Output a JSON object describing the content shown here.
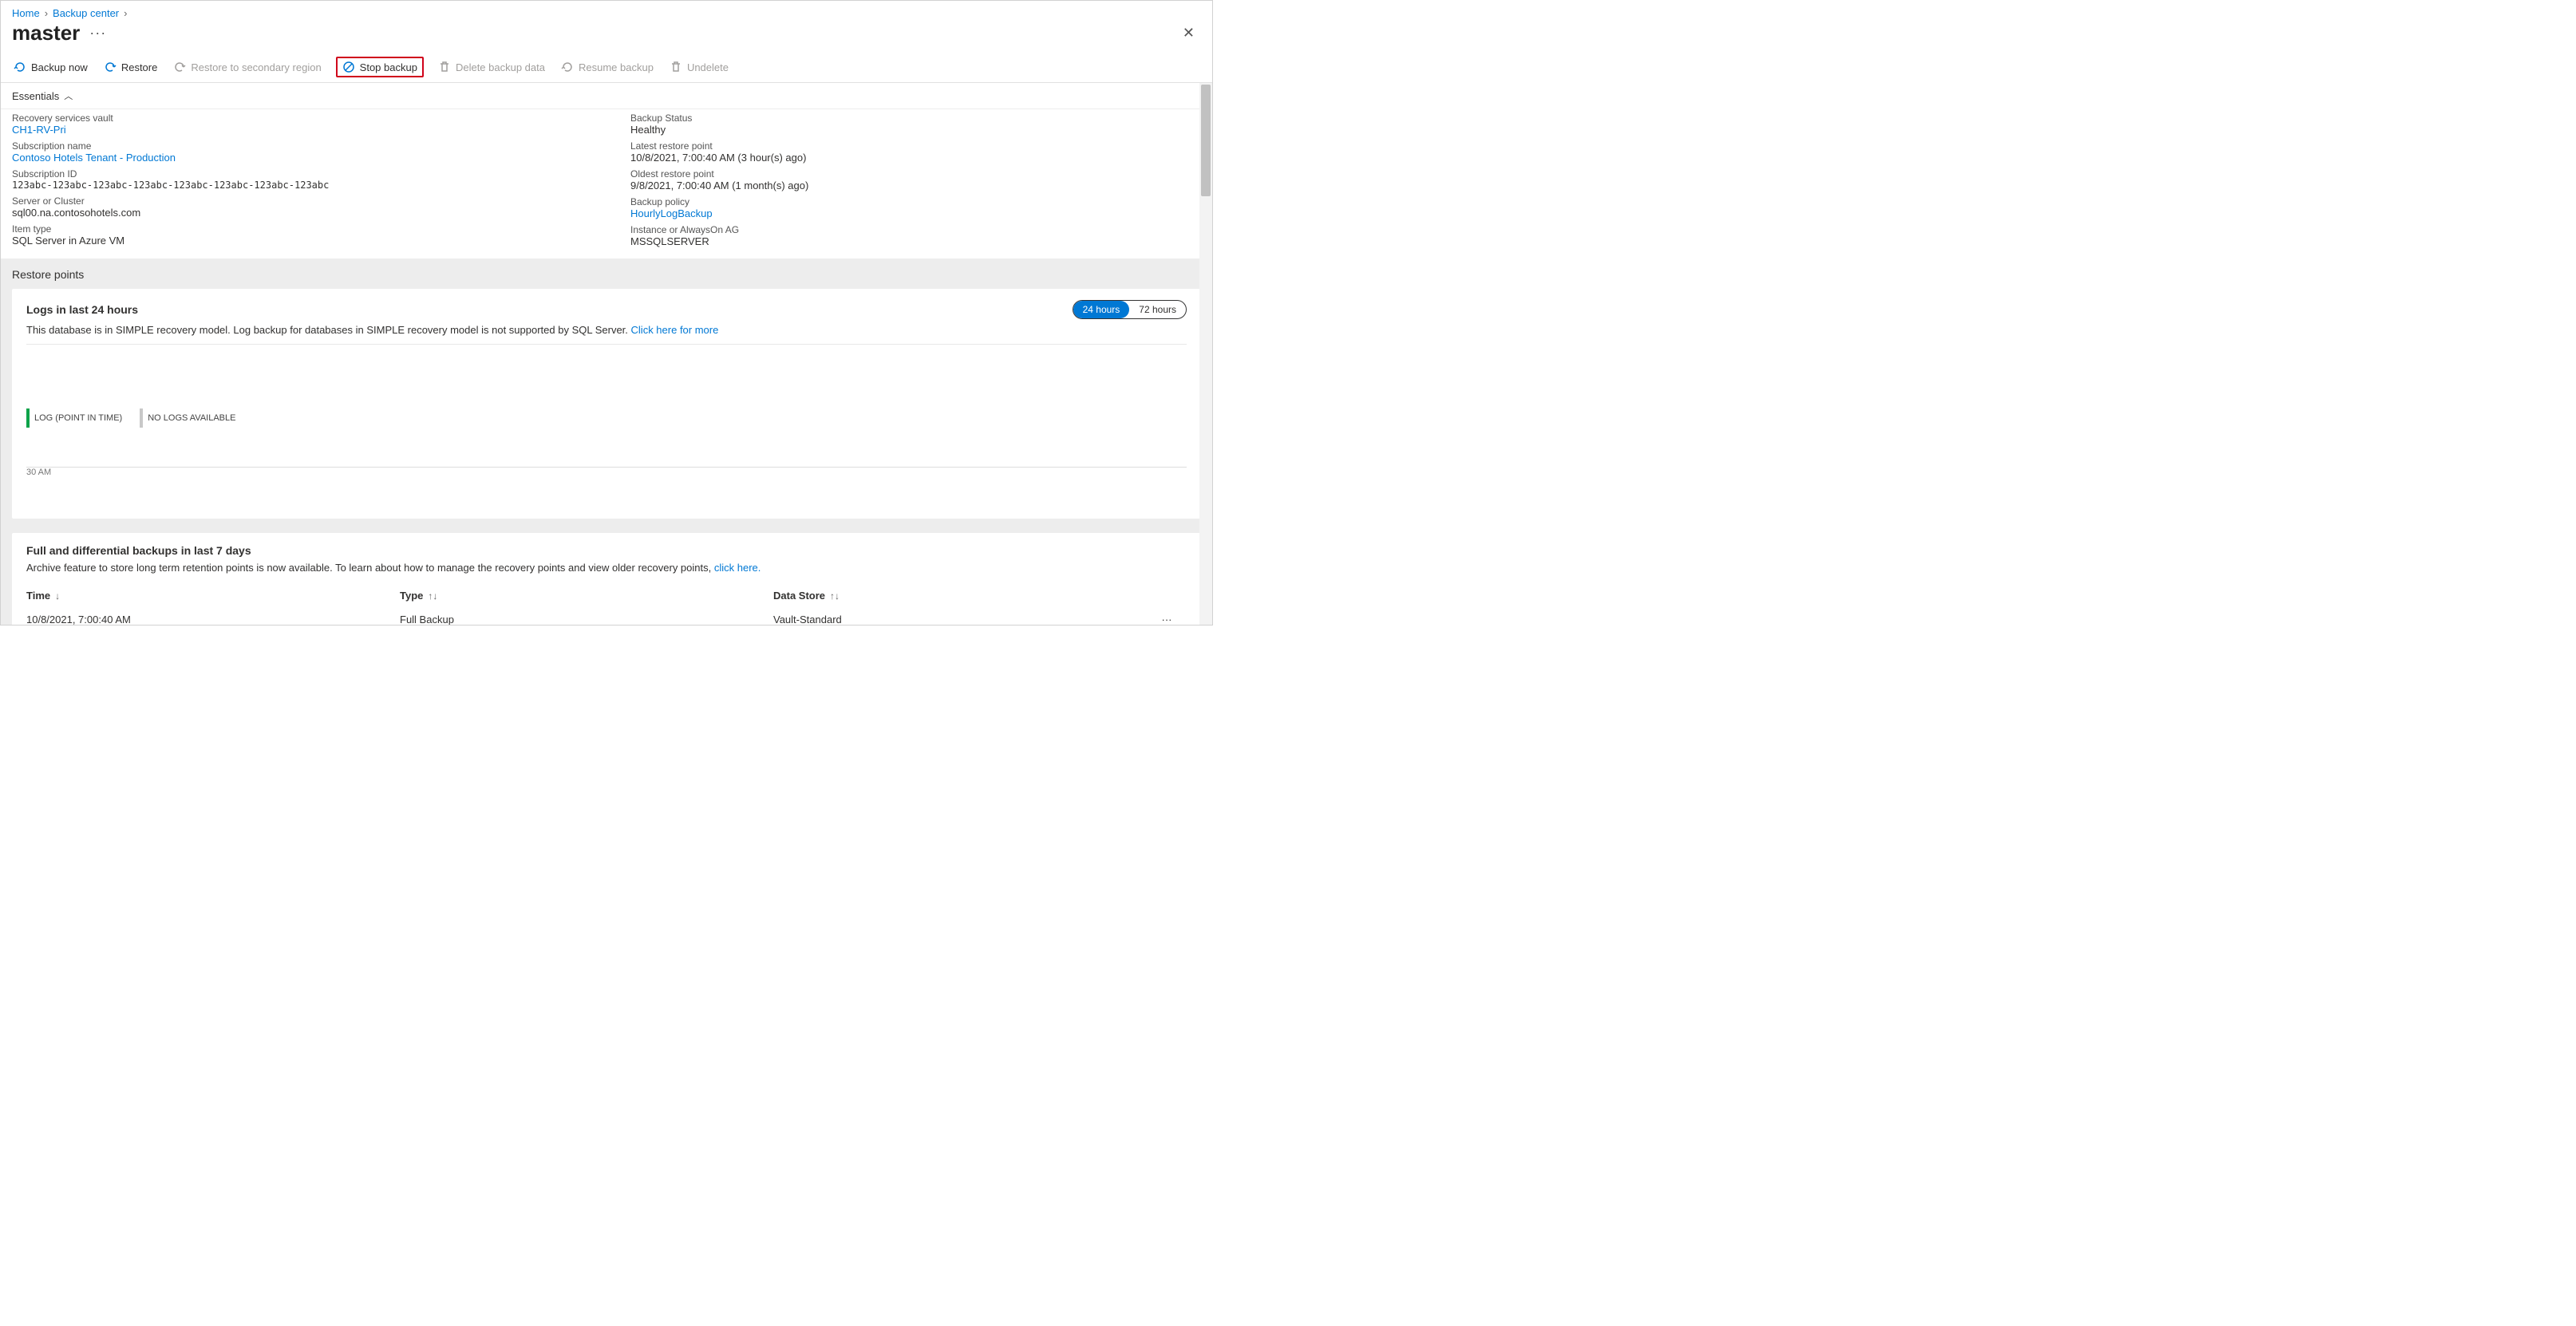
{
  "breadcrumb": {
    "home": "Home",
    "backup_center": "Backup center"
  },
  "page_title": "master",
  "toolbar": {
    "backup_now": "Backup now",
    "restore": "Restore",
    "restore_secondary": "Restore to secondary region",
    "stop_backup": "Stop backup",
    "delete_backup_data": "Delete backup data",
    "resume_backup": "Resume backup",
    "undelete": "Undelete"
  },
  "essentials_label": "Essentials",
  "essentials": {
    "left": {
      "vault_label": "Recovery services vault",
      "vault_value": "CH1-RV-Pri",
      "sub_name_label": "Subscription name",
      "sub_name_value": "Contoso Hotels Tenant - Production",
      "sub_id_label": "Subscription ID",
      "sub_id_value": "123abc-123abc-123abc-123abc-123abc-123abc-123abc-123abc",
      "server_label": "Server or Cluster",
      "server_value": "sql00.na.contosohotels.com",
      "item_type_label": "Item type",
      "item_type_value": "SQL Server in Azure VM"
    },
    "right": {
      "backup_status_label": "Backup Status",
      "backup_status_value": "Healthy",
      "latest_rp_label": "Latest restore point",
      "latest_rp_value": "10/8/2021, 7:00:40 AM (3 hour(s) ago)",
      "oldest_rp_label": "Oldest restore point",
      "oldest_rp_value": "9/8/2021, 7:00:40 AM (1 month(s) ago)",
      "policy_label": "Backup policy",
      "policy_value": "HourlyLogBackup",
      "instance_label": "Instance or AlwaysOn AG",
      "instance_value": "MSSQLSERVER"
    }
  },
  "restore_points_title": "Restore points",
  "logs_card": {
    "title": "Logs in last 24 hours",
    "note": "This database is in SIMPLE recovery model. Log backup for databases in SIMPLE recovery model is not supported by SQL Server.",
    "note_link": "Click here for more",
    "toggle_24": "24 hours",
    "toggle_72": "72 hours",
    "axis_label": "30 AM",
    "legend_point": "LOG (POINT IN TIME)",
    "legend_none": "NO LOGS AVAILABLE"
  },
  "backups_card": {
    "title": "Full and differential backups in last 7 days",
    "note": "Archive feature to store long term retention points is now available. To learn about how to manage the recovery points and view older recovery points,",
    "note_link": "click here.",
    "col_time": "Time",
    "col_type": "Type",
    "col_store": "Data Store",
    "row1_time": "10/8/2021, 7:00:40 AM",
    "row1_type": "Full Backup",
    "row1_store": "Vault-Standard"
  }
}
